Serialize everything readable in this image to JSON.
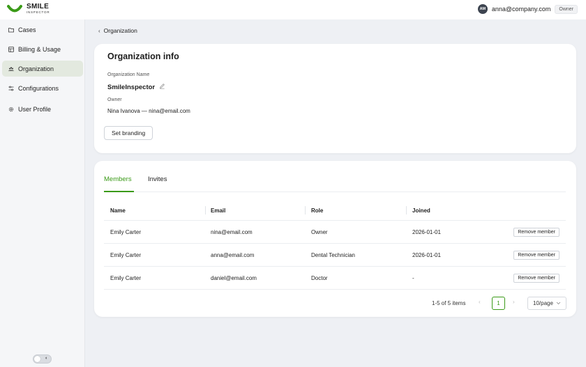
{
  "brand": {
    "name": "SMILE",
    "tagline": "INSPECTOR",
    "accent": "#3a9a17"
  },
  "header": {
    "avatar_initials": "AM",
    "user_email": "anna@company.com",
    "role_badge": "Owner"
  },
  "sidebar": {
    "items": [
      {
        "label": "Cases",
        "icon": "folder-icon",
        "active": false
      },
      {
        "label": "Billing & Usage",
        "icon": "receipt-icon",
        "active": false
      },
      {
        "label": "Organization",
        "icon": "team-icon",
        "active": true
      },
      {
        "label": "Configurations",
        "icon": "sliders-icon",
        "active": false
      },
      {
        "label": "User Profile",
        "icon": "gear-icon",
        "active": false
      }
    ],
    "theme_toggle_icon": "moon-icon"
  },
  "breadcrumb": {
    "back_icon": "chevron-left-icon",
    "label": "Organization"
  },
  "org_info": {
    "title": "Organization info",
    "name_label": "Organization Name",
    "name_value": "SmileInspector",
    "edit_icon": "pencil-icon",
    "owner_label": "Owner",
    "owner_value": "Nina Ivanova — nina@email.com",
    "branding_button": "Set branding"
  },
  "members": {
    "tabs": [
      {
        "label": "Members",
        "active": true
      },
      {
        "label": "Invites",
        "active": false
      }
    ],
    "columns": [
      "Name",
      "Email",
      "Role",
      "Joined"
    ],
    "rows": [
      {
        "name": "Emily Carter",
        "email": "nina@email.com",
        "role": "Owner",
        "joined": "2026-01-01",
        "action": "Remove member"
      },
      {
        "name": "Emily Carter",
        "email": "anna@email.com",
        "role": "Dental Technician",
        "joined": "2026-01-01",
        "action": "Remove member"
      },
      {
        "name": "Emily Carter",
        "email": "daniel@email.com",
        "role": "Doctor",
        "joined": "-",
        "action": "Remove member"
      }
    ],
    "pagination": {
      "total_text": "1-5 of 5 items",
      "current_page": "1",
      "page_size": "10/page"
    }
  }
}
